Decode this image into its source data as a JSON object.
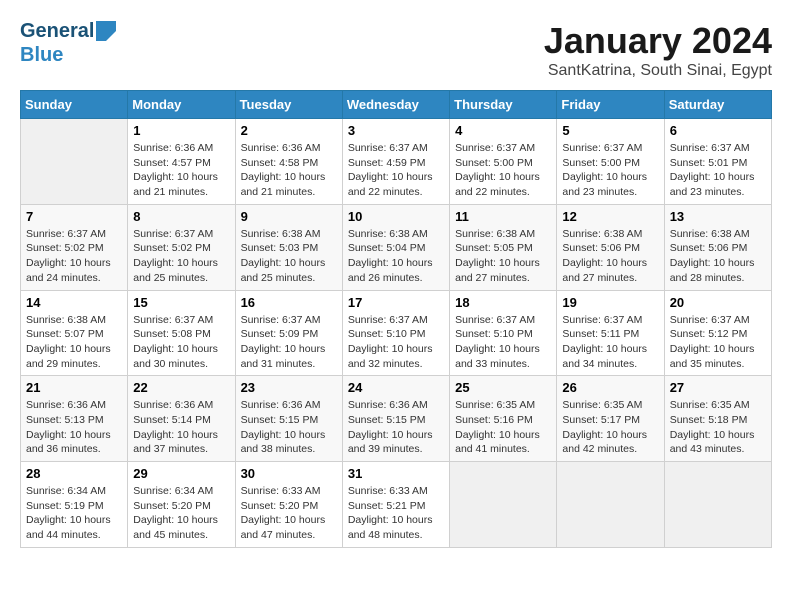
{
  "logo": {
    "line1": "General",
    "line2": "Blue"
  },
  "title": "January 2024",
  "subtitle": "SantKatrina, South Sinai, Egypt",
  "days_header": [
    "Sunday",
    "Monday",
    "Tuesday",
    "Wednesday",
    "Thursday",
    "Friday",
    "Saturday"
  ],
  "weeks": [
    [
      {
        "day": "",
        "content": ""
      },
      {
        "day": "1",
        "content": "Sunrise: 6:36 AM\nSunset: 4:57 PM\nDaylight: 10 hours\nand 21 minutes."
      },
      {
        "day": "2",
        "content": "Sunrise: 6:36 AM\nSunset: 4:58 PM\nDaylight: 10 hours\nand 21 minutes."
      },
      {
        "day": "3",
        "content": "Sunrise: 6:37 AM\nSunset: 4:59 PM\nDaylight: 10 hours\nand 22 minutes."
      },
      {
        "day": "4",
        "content": "Sunrise: 6:37 AM\nSunset: 5:00 PM\nDaylight: 10 hours\nand 22 minutes."
      },
      {
        "day": "5",
        "content": "Sunrise: 6:37 AM\nSunset: 5:00 PM\nDaylight: 10 hours\nand 23 minutes."
      },
      {
        "day": "6",
        "content": "Sunrise: 6:37 AM\nSunset: 5:01 PM\nDaylight: 10 hours\nand 23 minutes."
      }
    ],
    [
      {
        "day": "7",
        "content": "Sunrise: 6:37 AM\nSunset: 5:02 PM\nDaylight: 10 hours\nand 24 minutes."
      },
      {
        "day": "8",
        "content": "Sunrise: 6:37 AM\nSunset: 5:02 PM\nDaylight: 10 hours\nand 25 minutes."
      },
      {
        "day": "9",
        "content": "Sunrise: 6:38 AM\nSunset: 5:03 PM\nDaylight: 10 hours\nand 25 minutes."
      },
      {
        "day": "10",
        "content": "Sunrise: 6:38 AM\nSunset: 5:04 PM\nDaylight: 10 hours\nand 26 minutes."
      },
      {
        "day": "11",
        "content": "Sunrise: 6:38 AM\nSunset: 5:05 PM\nDaylight: 10 hours\nand 27 minutes."
      },
      {
        "day": "12",
        "content": "Sunrise: 6:38 AM\nSunset: 5:06 PM\nDaylight: 10 hours\nand 27 minutes."
      },
      {
        "day": "13",
        "content": "Sunrise: 6:38 AM\nSunset: 5:06 PM\nDaylight: 10 hours\nand 28 minutes."
      }
    ],
    [
      {
        "day": "14",
        "content": "Sunrise: 6:38 AM\nSunset: 5:07 PM\nDaylight: 10 hours\nand 29 minutes."
      },
      {
        "day": "15",
        "content": "Sunrise: 6:37 AM\nSunset: 5:08 PM\nDaylight: 10 hours\nand 30 minutes."
      },
      {
        "day": "16",
        "content": "Sunrise: 6:37 AM\nSunset: 5:09 PM\nDaylight: 10 hours\nand 31 minutes."
      },
      {
        "day": "17",
        "content": "Sunrise: 6:37 AM\nSunset: 5:10 PM\nDaylight: 10 hours\nand 32 minutes."
      },
      {
        "day": "18",
        "content": "Sunrise: 6:37 AM\nSunset: 5:10 PM\nDaylight: 10 hours\nand 33 minutes."
      },
      {
        "day": "19",
        "content": "Sunrise: 6:37 AM\nSunset: 5:11 PM\nDaylight: 10 hours\nand 34 minutes."
      },
      {
        "day": "20",
        "content": "Sunrise: 6:37 AM\nSunset: 5:12 PM\nDaylight: 10 hours\nand 35 minutes."
      }
    ],
    [
      {
        "day": "21",
        "content": "Sunrise: 6:36 AM\nSunset: 5:13 PM\nDaylight: 10 hours\nand 36 minutes."
      },
      {
        "day": "22",
        "content": "Sunrise: 6:36 AM\nSunset: 5:14 PM\nDaylight: 10 hours\nand 37 minutes."
      },
      {
        "day": "23",
        "content": "Sunrise: 6:36 AM\nSunset: 5:15 PM\nDaylight: 10 hours\nand 38 minutes."
      },
      {
        "day": "24",
        "content": "Sunrise: 6:36 AM\nSunset: 5:15 PM\nDaylight: 10 hours\nand 39 minutes."
      },
      {
        "day": "25",
        "content": "Sunrise: 6:35 AM\nSunset: 5:16 PM\nDaylight: 10 hours\nand 41 minutes."
      },
      {
        "day": "26",
        "content": "Sunrise: 6:35 AM\nSunset: 5:17 PM\nDaylight: 10 hours\nand 42 minutes."
      },
      {
        "day": "27",
        "content": "Sunrise: 6:35 AM\nSunset: 5:18 PM\nDaylight: 10 hours\nand 43 minutes."
      }
    ],
    [
      {
        "day": "28",
        "content": "Sunrise: 6:34 AM\nSunset: 5:19 PM\nDaylight: 10 hours\nand 44 minutes."
      },
      {
        "day": "29",
        "content": "Sunrise: 6:34 AM\nSunset: 5:20 PM\nDaylight: 10 hours\nand 45 minutes."
      },
      {
        "day": "30",
        "content": "Sunrise: 6:33 AM\nSunset: 5:20 PM\nDaylight: 10 hours\nand 47 minutes."
      },
      {
        "day": "31",
        "content": "Sunrise: 6:33 AM\nSunset: 5:21 PM\nDaylight: 10 hours\nand 48 minutes."
      },
      {
        "day": "",
        "content": ""
      },
      {
        "day": "",
        "content": ""
      },
      {
        "day": "",
        "content": ""
      }
    ]
  ]
}
